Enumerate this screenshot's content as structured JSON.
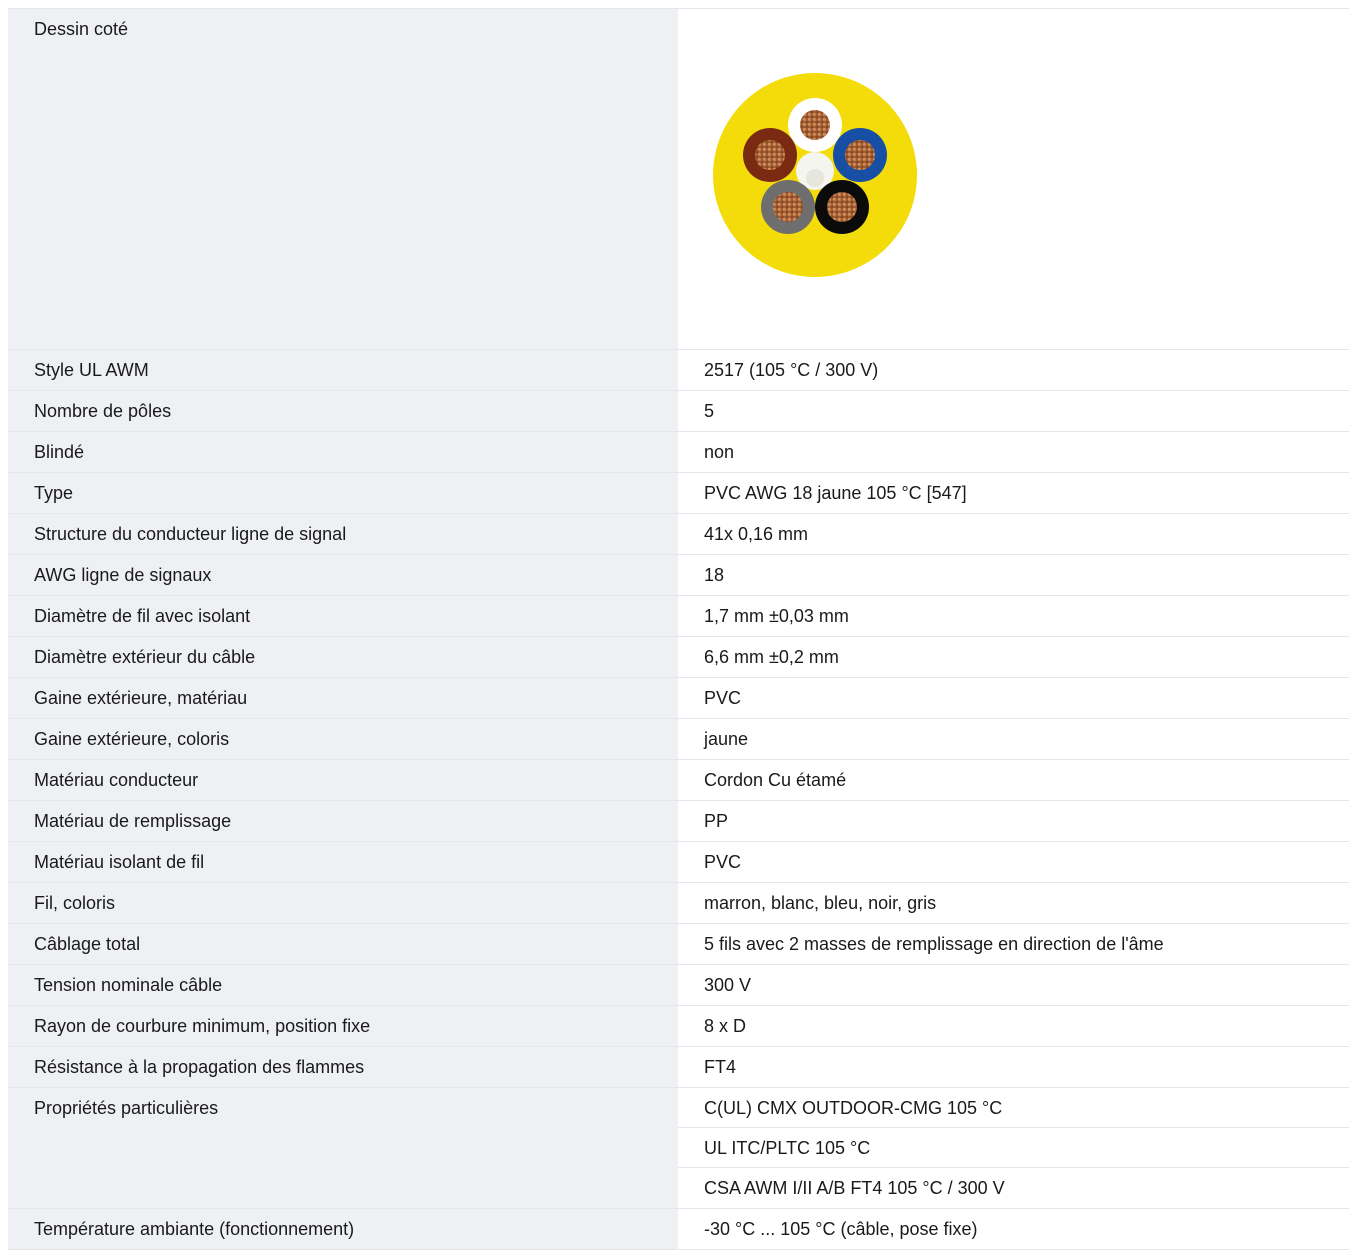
{
  "drawing": {
    "label": "Dessin coté",
    "image_alt": "cable-cross-section",
    "colors": {
      "jacket": "#f3dc0a",
      "brown": "#7a2a10",
      "white": "#ffffff",
      "blue": "#164fa3",
      "grey": "#6e6e6e",
      "black": "#0b0b0b",
      "filler": "#f5f5f0",
      "copper": "#b06b3e"
    }
  },
  "rows": [
    {
      "label": "Style UL AWM",
      "value": "2517 (105 °C / 300 V)"
    },
    {
      "label": "Nombre de pôles",
      "value": "5"
    },
    {
      "label": "Blindé",
      "value": "non"
    },
    {
      "label": "Type",
      "value": "PVC AWG 18 jaune 105 °C [547]"
    },
    {
      "label": "Structure du conducteur ligne de signal",
      "value": "41x 0,16 mm"
    },
    {
      "label": "AWG ligne de signaux",
      "value": "18"
    },
    {
      "label": "Diamètre de fil avec isolant",
      "value": "1,7 mm ±0,03 mm"
    },
    {
      "label": "Diamètre extérieur du câble",
      "value": "6,6 mm ±0,2 mm"
    },
    {
      "label": "Gaine extérieure, matériau",
      "value": "PVC"
    },
    {
      "label": "Gaine extérieure, coloris",
      "value": "jaune"
    },
    {
      "label": "Matériau conducteur",
      "value": "Cordon Cu étamé"
    },
    {
      "label": "Matériau de remplissage",
      "value": "PP"
    },
    {
      "label": "Matériau isolant de fil",
      "value": "PVC"
    },
    {
      "label": "Fil, coloris",
      "value": "marron, blanc, bleu, noir, gris"
    },
    {
      "label": "Câblage total",
      "value": "5 fils avec 2 masses de remplissage en direction de l'âme"
    },
    {
      "label": "Tension nominale câble",
      "value": "300 V"
    },
    {
      "label": "Rayon de courbure minimum, position fixe",
      "value": "8 x D"
    },
    {
      "label": "Résistance à la propagation des flammes",
      "value": "FT4"
    }
  ],
  "special": {
    "label": "Propriétés particulières",
    "values": [
      "C(UL) CMX OUTDOOR-CMG 105 °C",
      "UL ITC/PLTC 105 °C",
      "CSA AWM I/II A/B FT4 105 °C / 300 V"
    ]
  },
  "last_row": {
    "label": "Température ambiante (fonctionnement)",
    "value": "-30 °C ... 105 °C (câble, pose fixe)"
  }
}
